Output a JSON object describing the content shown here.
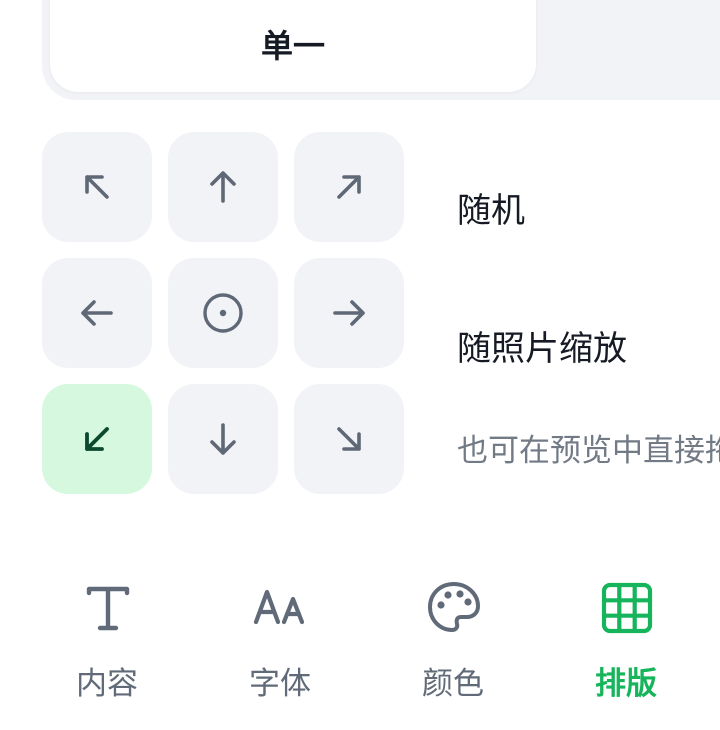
{
  "segmented_control": {
    "active_label": "单一"
  },
  "direction_grid": {
    "cells": [
      {
        "icon": "arrow-up-left-icon",
        "active": false
      },
      {
        "icon": "arrow-up-icon",
        "active": false
      },
      {
        "icon": "arrow-up-right-icon",
        "active": false
      },
      {
        "icon": "arrow-left-icon",
        "active": false
      },
      {
        "icon": "target-center-icon",
        "active": false
      },
      {
        "icon": "arrow-right-icon",
        "active": false
      },
      {
        "icon": "arrow-down-left-icon",
        "active": true
      },
      {
        "icon": "arrow-down-icon",
        "active": false
      },
      {
        "icon": "arrow-down-right-icon",
        "active": false
      }
    ]
  },
  "options": {
    "random_label": "随机",
    "scale_label": "随照片缩放",
    "hint": "也可在预览中直接拖"
  },
  "tab_bar": {
    "tabs": [
      {
        "label": "内容",
        "icon": "text-t-icon",
        "active": false
      },
      {
        "label": "字体",
        "icon": "font-aa-icon",
        "active": false
      },
      {
        "label": "颜色",
        "icon": "palette-icon",
        "active": false
      },
      {
        "label": "排版",
        "icon": "grid-layout-icon",
        "active": true
      }
    ]
  },
  "colors": {
    "accent_green": "#16b45b",
    "active_cell_bg": "#d5f8df",
    "active_arrow": "#0b4a2d",
    "cell_bg": "#f2f3f7",
    "icon_gray": "#616a78"
  }
}
